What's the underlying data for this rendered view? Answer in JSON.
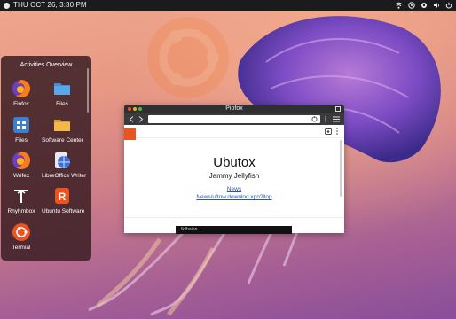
{
  "topbar": {
    "clock": "THU OCT 26, 3:30 PM",
    "left_icon": "activities-dot-icon",
    "tray_icons": [
      "wifi-icon",
      "ubuntu-icon",
      "settings-icon",
      "volume-icon",
      "power-icon"
    ]
  },
  "activities": {
    "title": "Activities Overview",
    "apps": [
      {
        "label": "Finfox",
        "icon": "firefox-icon"
      },
      {
        "label": "Files",
        "icon": "folder-icon"
      },
      {
        "label": "Files",
        "icon": "apps-grid-icon"
      },
      {
        "label": "Software Center",
        "icon": "folder-icon"
      },
      {
        "label": "Wrifex",
        "icon": "firefox-icon"
      },
      {
        "label": "LibreOffice Writer",
        "icon": "globe-icon"
      },
      {
        "label": "Rhyhmbox",
        "icon": "rhythmbox-icon"
      },
      {
        "label": "Ubuntu Software",
        "icon": "ubuntu-software-icon"
      },
      {
        "label": "Termial",
        "icon": "terminal-icon"
      }
    ]
  },
  "browser": {
    "window_title": "Piofox",
    "page_title": "Ubutox",
    "page_subtitle": "Jammy Jellyfish",
    "link1": "News",
    "link2": "News/uftow.downlod.xpn?ilop",
    "notification": "Ikilbaion..."
  },
  "colors": {
    "accent": "#e95420",
    "panel": "#3a1e24",
    "topbar": "#1b1b1d",
    "link": "#2a4fbf"
  }
}
